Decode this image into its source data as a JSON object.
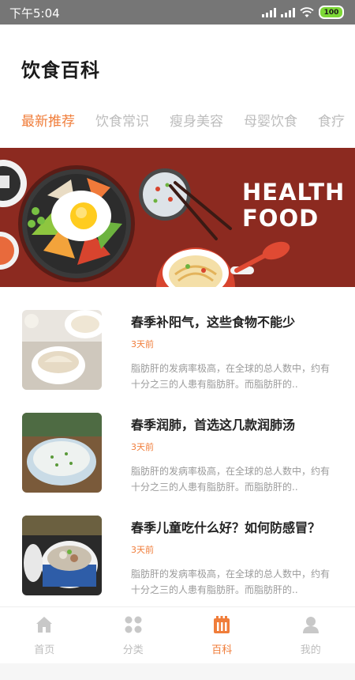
{
  "status_bar": {
    "time": "下午5:04",
    "battery": "100"
  },
  "header": {
    "title": "饮食百科"
  },
  "tabs": [
    {
      "label": "最新推荐",
      "active": true
    },
    {
      "label": "饮食常识",
      "active": false
    },
    {
      "label": "瘦身美容",
      "active": false
    },
    {
      "label": "母婴饮食",
      "active": false
    },
    {
      "label": "食疗",
      "active": false
    }
  ],
  "banner": {
    "line1": "HEALTH",
    "line2": "FOOD"
  },
  "articles": [
    {
      "title": "春季补阳气，这些食物不能少",
      "time": "3天前",
      "desc": "脂肪肝的发病率极高，在全球的总人数中，约有十分之三的人患有脂肪肝。而脂肪肝的.."
    },
    {
      "title": "春季润肺，首选这几款润肺汤",
      "time": "3天前",
      "desc": "脂肪肝的发病率极高，在全球的总人数中，约有十分之三的人患有脂肪肝。而脂肪肝的.."
    },
    {
      "title": "春季儿童吃什么好？如何防感冒？",
      "time": "3天前",
      "desc": "脂肪肝的发病率极高，在全球的总人数中，约有十分之三的人患有脂肪肝。而脂肪肝的.."
    }
  ],
  "bottom_nav": [
    {
      "label": "首页",
      "icon": "home-icon",
      "active": false
    },
    {
      "label": "分类",
      "icon": "grid-icon",
      "active": false
    },
    {
      "label": "百科",
      "icon": "encyclopedia-icon",
      "active": true
    },
    {
      "label": "我的",
      "icon": "user-icon",
      "active": false
    }
  ],
  "colors": {
    "accent": "#f07d3a",
    "banner_bg": "#8c2a20",
    "status_bar": "#767676",
    "inactive": "#bdbdbd"
  }
}
